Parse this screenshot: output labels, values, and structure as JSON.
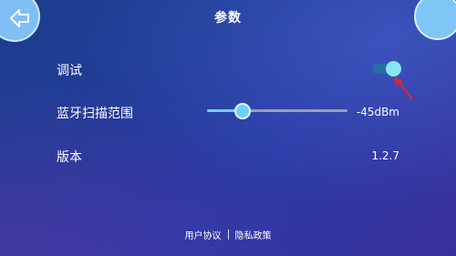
{
  "header": {
    "title": "参数",
    "back_icon": "back-arrow-icon"
  },
  "settings": {
    "debug": {
      "label": "调试",
      "enabled": true
    },
    "bluetooth_range": {
      "label": "蓝牙扫描范围",
      "value": "-45dBm",
      "slider_level": 0.25
    },
    "version": {
      "label": "版本",
      "value": "1.2.7"
    }
  },
  "footer": {
    "user_agreement": "用户协议",
    "privacy_policy": "隐私政策"
  },
  "colors": {
    "accent": "#6fcfff",
    "toggle_knob": "#86e7f2",
    "arrow": "#e0262b"
  }
}
